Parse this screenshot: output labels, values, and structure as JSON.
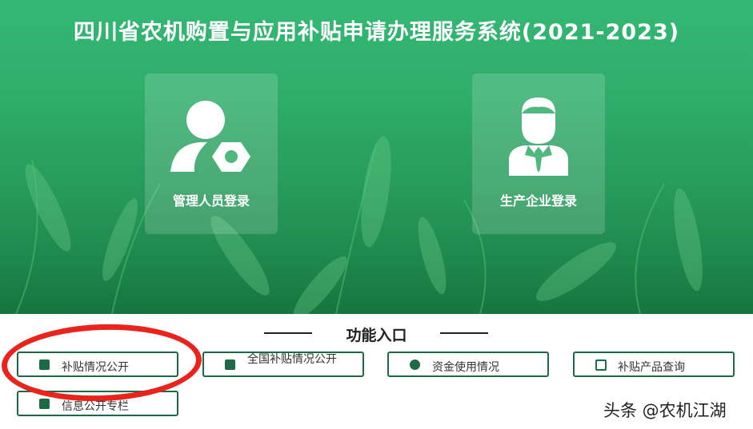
{
  "header": {
    "title": "四川省农机购置与应用补贴申请办理服务系统(2021-2023)"
  },
  "logins": [
    {
      "label": "管理人员登录",
      "icon": "admin-gear-icon"
    },
    {
      "label": "生产企业登录",
      "icon": "business-person-icon"
    }
  ],
  "functions": {
    "title": "功能入口",
    "buttons": [
      {
        "label": "补贴情况公开",
        "icon": "subsidy-icon"
      },
      {
        "label": "全国补贴情况公开",
        "icon": "national-subsidy-icon"
      },
      {
        "label": "资金使用情况",
        "icon": "fund-icon"
      },
      {
        "label": "补贴产品查询",
        "icon": "search-doc-icon"
      },
      {
        "label": "信息公开专栏",
        "icon": "document-icon"
      }
    ]
  },
  "watermark": {
    "text": "头条 @农机江湖"
  },
  "colors": {
    "brand_green": "#2fae6a",
    "button_border": "#1c6a46",
    "highlight_red": "#e8241c"
  }
}
